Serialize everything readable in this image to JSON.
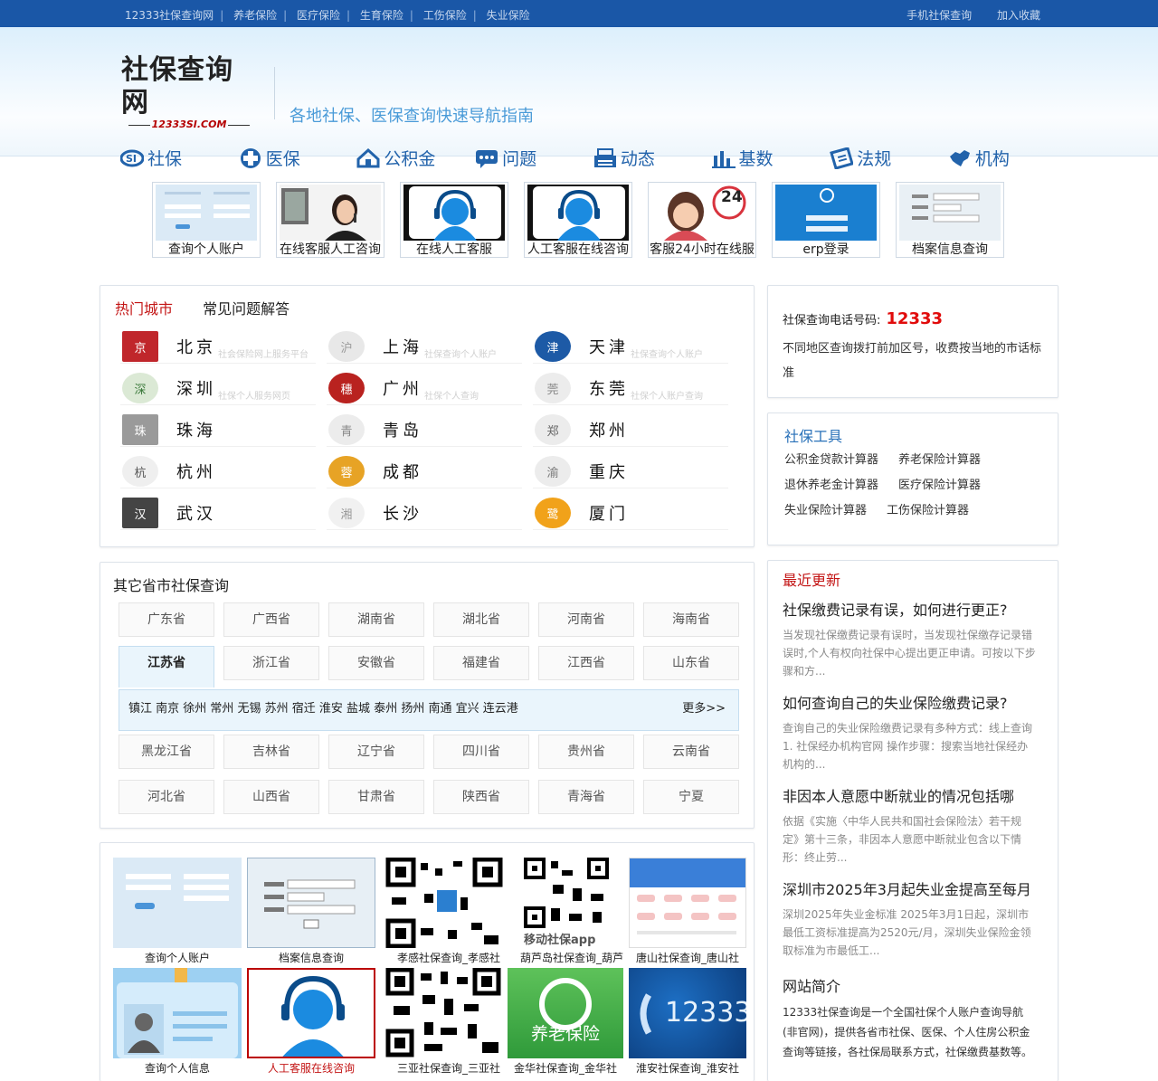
{
  "topbar": {
    "links": [
      "12333社保查询网",
      "养老保险",
      "医疗保险",
      "生育保险",
      "工伤保险",
      "失业保险"
    ],
    "right": [
      "手机社保查询",
      "加入收藏"
    ]
  },
  "header": {
    "logo_title": "社保查询网",
    "logo_domain": "12333SI.COM",
    "slogan": "各地社保、医保查询快速导航指南"
  },
  "nav": [
    {
      "label": "社保",
      "icon": "si-logo-icon"
    },
    {
      "label": "医保",
      "icon": "medical-cross-icon"
    },
    {
      "label": "公积金",
      "icon": "house-icon"
    },
    {
      "label": "问题",
      "icon": "chat-bubble-icon"
    },
    {
      "label": "动态",
      "icon": "printer-icon"
    },
    {
      "label": "基数",
      "icon": "bar-chart-icon"
    },
    {
      "label": "法规",
      "icon": "law-book-icon"
    },
    {
      "label": "机构",
      "icon": "china-map-icon"
    }
  ],
  "shortcuts": [
    {
      "label": "查询个人账户",
      "icon": "login-form-icon"
    },
    {
      "label": "在线客服人工咨询",
      "icon": "agent-photo-icon"
    },
    {
      "label": "在线人工客服",
      "icon": "headset-agent-icon"
    },
    {
      "label": "人工客服在线咨询",
      "icon": "headset-agent-icon"
    },
    {
      "label": "客服24小时在线服",
      "icon": "24-hours-agent-icon"
    },
    {
      "label": "erp登录",
      "icon": "member-login-icon"
    },
    {
      "label": "档案信息查询",
      "icon": "archive-form-icon"
    }
  ],
  "hot": {
    "tabs": [
      "热门城市",
      "常见问题解答"
    ],
    "cities": [
      {
        "name": "北京",
        "tip": "社会保险网上服务平台"
      },
      {
        "name": "上海",
        "tip": "社保查询个人账户"
      },
      {
        "name": "天津",
        "tip": "社保查询个人账户"
      },
      {
        "name": "深圳",
        "tip": "社保个人服务网页"
      },
      {
        "name": "广州",
        "tip": "社保个人查询"
      },
      {
        "name": "东莞",
        "tip": "社保个人账户查询"
      },
      {
        "name": "珠海",
        "tip": ""
      },
      {
        "name": "青岛",
        "tip": ""
      },
      {
        "name": "郑州",
        "tip": ""
      },
      {
        "name": "杭州",
        "tip": ""
      },
      {
        "name": "成都",
        "tip": ""
      },
      {
        "name": "重庆",
        "tip": ""
      },
      {
        "name": "武汉",
        "tip": ""
      },
      {
        "name": "长沙",
        "tip": ""
      },
      {
        "name": "厦门",
        "tip": ""
      }
    ]
  },
  "phone": {
    "label": "社保查询电话号码:",
    "number": "12333",
    "note": "不同地区查询拨打前加区号，收费按当地的市话标准"
  },
  "tools": {
    "title": "社保工具",
    "rows": [
      [
        "公积金贷款计算器",
        "养老保险计算器"
      ],
      [
        "退休养老金计算器",
        "医疗保险计算器"
      ],
      [
        "失业保险计算器",
        "工伤保险计算器"
      ]
    ]
  },
  "provinces": {
    "title": "其它省市社保查询",
    "rows": [
      [
        "广东省",
        "广西省",
        "湖南省",
        "湖北省",
        "河南省",
        "海南省"
      ],
      [
        "江苏省",
        "浙江省",
        "安徽省",
        "福建省",
        "江西省",
        "山东省"
      ],
      [
        "黑龙江省",
        "吉林省",
        "辽宁省",
        "四川省",
        "贵州省",
        "云南省"
      ],
      [
        "河北省",
        "山西省",
        "甘肃省",
        "陕西省",
        "青海省",
        "宁夏"
      ]
    ],
    "active": "江苏省",
    "active_cities": "镇江 南京 徐州 常州 无锡 苏州 宿迁 淮安 盐城 泰州 扬州 南通 宜兴 连云港",
    "more": "更多>>"
  },
  "news": {
    "title": "最近更新",
    "items": [
      {
        "title": "社保缴费记录有误，如何进行更正?",
        "desc": "当发现社保缴费记录有误时，当发现社保缴存记录错误时,个人有权向社保中心提出更正申请。可按以下步骤和方..."
      },
      {
        "title": "如何查询自己的失业保险缴费记录?",
        "desc": "查询自己的失业保险缴费记录有多种方式：线上查询 1. 社保经办机构官网 操作步骤：搜索当地社保经办机构的..."
      },
      {
        "title": "非因本人意愿中断就业的情况包括哪",
        "desc": "依据《实施〈中华人民共和国社会保险法〉若干规定》第十三条，非因本人意愿中断就业包含以下情形：终止劳..."
      },
      {
        "title": "深圳市2025年3月起失业金提高至每月",
        "desc": "深圳2025年失业金标准 2025年3月1日起，深圳市最低工资标准提高为2520元/月，深圳失业保险金领取标准为市最低工..."
      },
      {
        "title": "网站简介",
        "desc": "12333社保查询是一个全国社保个人账户查询导航(非官网)，提供各省市社保、医保、个人住房公积金查询等链接，各社保局联系方式，社保缴费基数等。"
      }
    ]
  },
  "gallery": [
    {
      "label": "查询个人账户",
      "icon": "login-form-icon",
      "highlight": false
    },
    {
      "label": "档案信息查询",
      "icon": "archive-form-icon",
      "highlight": false
    },
    {
      "label": "孝感社保查询_孝感社",
      "icon": "qr-code-icon",
      "highlight": false
    },
    {
      "label": "葫芦岛社保查询_葫芦",
      "icon": "qr-code-icon",
      "highlight": false
    },
    {
      "label": "唐山社保查询_唐山社",
      "icon": "website-preview-icon",
      "highlight": false
    },
    {
      "label": "查询个人信息",
      "icon": "id-card-icon",
      "highlight": false
    },
    {
      "label": "人工客服在线咨询",
      "icon": "headset-agent-icon",
      "highlight": true
    },
    {
      "label": "三亚社保查询_三亚社",
      "icon": "qr-code-icon",
      "highlight": false
    },
    {
      "label": "金华社保查询_金华社",
      "icon": "pension-logo-icon",
      "highlight": false
    },
    {
      "label": "淮安社保查询_淮安社",
      "icon": "phone-12333-icon",
      "highlight": false
    }
  ],
  "gallery_text": {
    "mobile_app": "移动社保app",
    "pension": "养老保险",
    "hotline": "12333"
  },
  "colors": {
    "topbar": "#1a57a7",
    "nav_text": "#2263ab",
    "accent_red": "#c31515",
    "link_blue": "#2870b8"
  }
}
